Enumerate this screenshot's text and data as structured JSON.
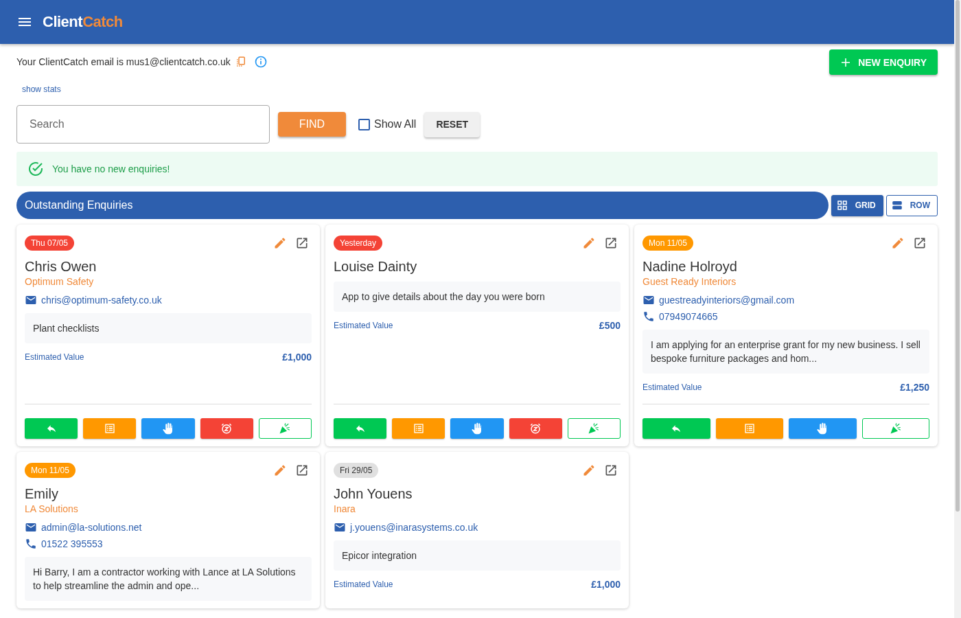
{
  "header": {
    "logo": {
      "text": "Client",
      "accent": "Catch"
    }
  },
  "email_notice": {
    "text": "Your ClientCatch email is mus1@clientcatch.co.uk"
  },
  "new_enquiry_button": "NEW ENQUIRY",
  "stats_link": "show stats",
  "search": {
    "placeholder": "Search",
    "find_button": "FIND",
    "show_all": {
      "label": "Show All",
      "checked": false
    },
    "reset_button": "RESET"
  },
  "notice": "You have no new enquiries!",
  "section": {
    "title": "Outstanding Enquiries",
    "views": [
      {
        "label": "GRID",
        "kind": "grid",
        "selected": true
      },
      {
        "label": "ROW",
        "kind": "row",
        "selected": false
      }
    ]
  },
  "cards": [
    {
      "date": "Thu 07/05",
      "color": "#f44336",
      "name": "Chris Owen",
      "company": "Optimum Safety",
      "email": "chris@optimum-safety.co.uk",
      "note": "Plant checklists",
      "value_label": "Estimated Value",
      "value": "£1,000",
      "actions": [
        {
          "kind": "reply"
        },
        {
          "kind": "notes"
        },
        {
          "kind": "hold"
        },
        {
          "kind": "snooze"
        },
        {
          "kind": "won"
        }
      ]
    },
    {
      "date": "Yesterday",
      "color": "#f44336",
      "name": "Louise Dainty",
      "note": "App to give details about the day you were born",
      "value_label": "Estimated Value",
      "value": "£500",
      "actions": [
        {
          "kind": "reply"
        },
        {
          "kind": "notes"
        },
        {
          "kind": "hold"
        },
        {
          "kind": "snooze"
        },
        {
          "kind": "won"
        }
      ]
    },
    {
      "date": "Mon 11/05",
      "color": "#ff9800",
      "name": "Nadine Holroyd",
      "company": "Guest Ready Interiors",
      "email": "guestreadyinteriors@gmail.com",
      "phone": "07949074665",
      "note": "I am applying for an enterprise grant for my new business. I sell bespoke furniture packages and hom...",
      "value_label": "Estimated Value",
      "value": "£1,250",
      "actions": [
        {
          "kind": "reply"
        },
        {
          "kind": "notes"
        },
        {
          "kind": "hold"
        },
        {
          "kind": "won"
        }
      ]
    },
    {
      "date": "Mon 11/05",
      "color": "#ff9800",
      "name": "Emily",
      "company": "LA Solutions",
      "email": "admin@la-solutions.net",
      "phone": "01522 395553",
      "note": "Hi Barry, I am a contractor working with Lance at LA Solutions to help streamline the admin and ope..."
    },
    {
      "date": "Fri 29/05",
      "color": "#e0e0e0",
      "name": "John Youens",
      "company": "Inara",
      "email": "j.youens@inarasystems.co.uk",
      "note": "Epicor integration",
      "value_label": "Estimated Value",
      "value": "£1,000"
    }
  ]
}
